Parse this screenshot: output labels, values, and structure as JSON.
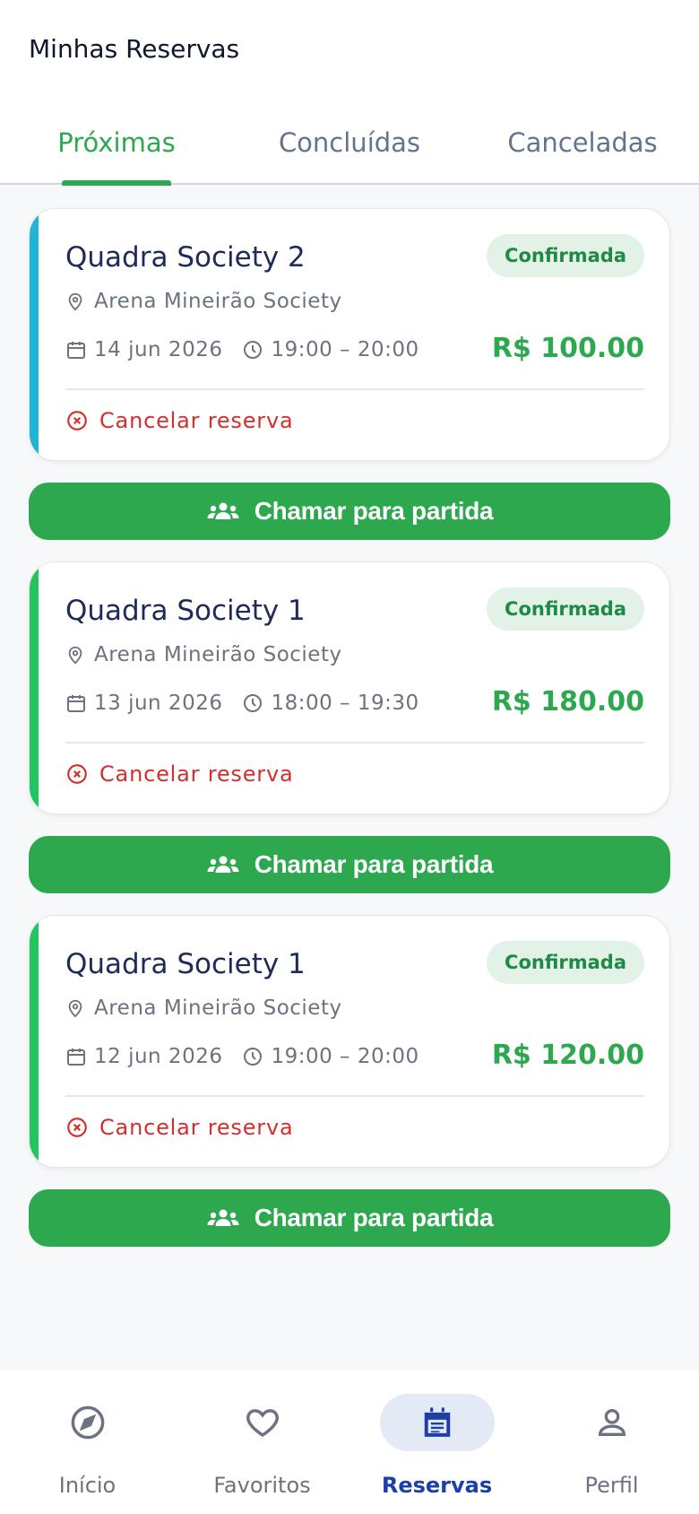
{
  "header": {
    "title": "Minhas Reservas",
    "tabs": [
      {
        "label": "Próximas",
        "active": true
      },
      {
        "label": "Concluídas",
        "active": false
      },
      {
        "label": "Canceladas",
        "active": false
      }
    ]
  },
  "colors": {
    "primary_green": "#2ea84f",
    "cancel_red": "#d32f2f",
    "nav_active": "#1e3ea8",
    "stripe_cyan": "#1fb5d4",
    "stripe_green": "#22c55e"
  },
  "bookings": [
    {
      "court": "Quadra Society 2",
      "status": "Confirmada",
      "venue": "Arena Mineirão Society",
      "date": "14 jun 2026",
      "time": "19:00 – 20:00",
      "price": "R$ 100.00",
      "cancel_label": "Cancelar reserva",
      "stripe_color": "#1fb5d4"
    },
    {
      "court": "Quadra Society 1",
      "status": "Confirmada",
      "venue": "Arena Mineirão Society",
      "date": "13 jun 2026",
      "time": "18:00 – 19:30",
      "price": "R$ 180.00",
      "cancel_label": "Cancelar reserva",
      "stripe_color": "#22c55e"
    },
    {
      "court": "Quadra Society 1",
      "status": "Confirmada",
      "venue": "Arena Mineirão Society",
      "date": "12 jun 2026",
      "time": "19:00 – 20:00",
      "price": "R$ 120.00",
      "cancel_label": "Cancelar reserva",
      "stripe_color": "#22c55e"
    }
  ],
  "call_button_label": "Chamar para partida",
  "bottom_nav": [
    {
      "label": "Início",
      "icon": "compass-icon",
      "active": false
    },
    {
      "label": "Favoritos",
      "icon": "heart-icon",
      "active": false
    },
    {
      "label": "Reservas",
      "icon": "calendar-icon",
      "active": true
    },
    {
      "label": "Perfil",
      "icon": "person-icon",
      "active": false
    }
  ]
}
